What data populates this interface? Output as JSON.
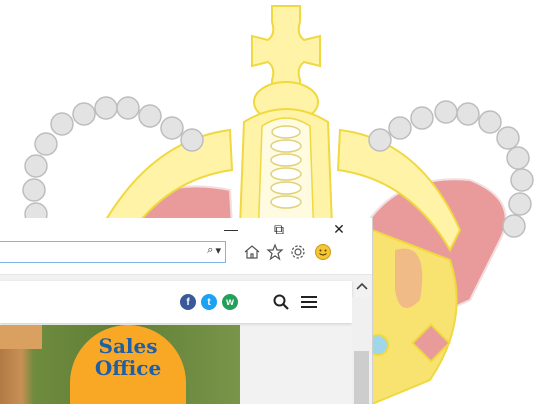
{
  "wallpaper": {
    "description_icon": "crown-icon",
    "colors": {
      "gold": "#f5e36b",
      "gold_light": "#fff8b8",
      "red": "#e99b9b",
      "pearl": "#e3e3e3",
      "pearl_edge": "#bdbdbd"
    }
  },
  "window": {
    "caption_buttons": {
      "minimize": "—",
      "restore": "⧉",
      "close": "✕"
    },
    "address_bar": {
      "value": "",
      "search_glyph": "⌕",
      "dropdown_glyph": "▾"
    },
    "toolbar_icons": [
      "home-icon",
      "star-icon",
      "gear-icon",
      "smiley-icon"
    ]
  },
  "page": {
    "social_icons": [
      "facebook-icon",
      "twitter-icon",
      "whatsapp-icon",
      "chat-icon"
    ],
    "social_glyphs": {
      "facebook": "f",
      "twitter": "t",
      "whatsapp": "w"
    },
    "badge": {
      "line1": "Sales",
      "line2": "Office"
    },
    "colors": {
      "badge_bg": "#f9a826",
      "badge_text": "#1e5fa5"
    }
  }
}
